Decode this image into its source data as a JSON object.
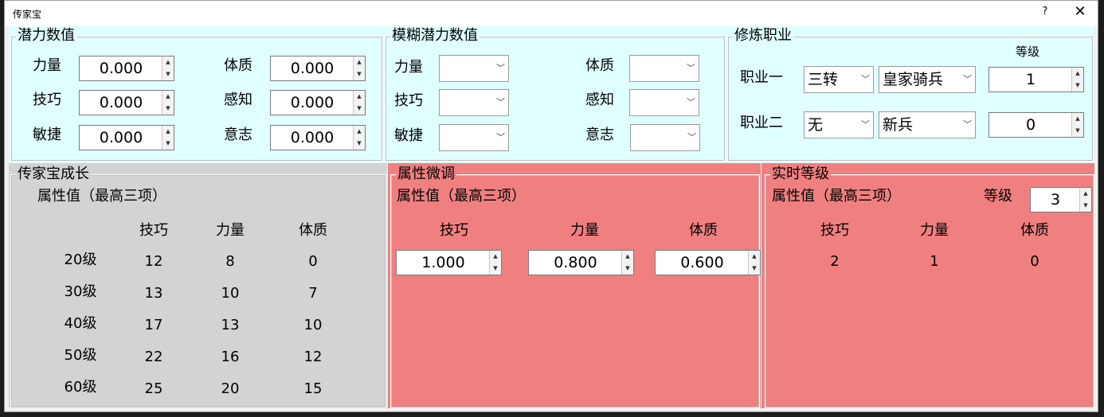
{
  "window": {
    "title": "传家宝",
    "help": "?",
    "close": "✕"
  },
  "potential": {
    "title": "潜力数值",
    "fields": [
      {
        "label": "力量",
        "value": "0.000"
      },
      {
        "label": "技巧",
        "value": "0.000"
      },
      {
        "label": "敏捷",
        "value": "0.000"
      },
      {
        "label": "体质",
        "value": "0.000"
      },
      {
        "label": "感知",
        "value": "0.000"
      },
      {
        "label": "意志",
        "value": "0.000"
      }
    ]
  },
  "fuzzy": {
    "title": "模糊潜力数值",
    "fields": [
      {
        "label": "力量",
        "value": ""
      },
      {
        "label": "技巧",
        "value": ""
      },
      {
        "label": "敏捷",
        "value": ""
      },
      {
        "label": "体质",
        "value": ""
      },
      {
        "label": "感知",
        "value": ""
      },
      {
        "label": "意志",
        "value": ""
      }
    ]
  },
  "jobs": {
    "title": "修炼职业",
    "level_header": "等级",
    "rows": [
      {
        "label": "职业一",
        "stage": "三转",
        "job": "皇家骑兵",
        "level": "1"
      },
      {
        "label": "职业二",
        "stage": "无",
        "job": "新兵",
        "level": "0"
      }
    ]
  },
  "growth": {
    "title": "传家宝成长",
    "subtitle": "属性值（最高三项）",
    "headers": [
      "技巧",
      "力量",
      "体质"
    ],
    "rows": [
      {
        "level": "20级",
        "values": [
          "12",
          "8",
          "0"
        ]
      },
      {
        "level": "30级",
        "values": [
          "13",
          "10",
          "7"
        ]
      },
      {
        "level": "40级",
        "values": [
          "17",
          "13",
          "10"
        ]
      },
      {
        "level": "50级",
        "values": [
          "22",
          "16",
          "12"
        ]
      },
      {
        "level": "60级",
        "values": [
          "25",
          "20",
          "15"
        ]
      }
    ]
  },
  "tweak": {
    "title": "属性微调",
    "subtitle": "属性值（最高三项）",
    "headers": [
      "技巧",
      "力量",
      "体质"
    ],
    "values": [
      "1.000",
      "0.800",
      "0.600"
    ]
  },
  "realtime": {
    "title": "实时等级",
    "subtitle": "属性值（最高三项）",
    "level_label": "等级",
    "level_value": "3",
    "headers": [
      "技巧",
      "力量",
      "体质"
    ],
    "values": [
      "2",
      "1",
      "0"
    ]
  },
  "colors": {
    "cyan_panel": "#e0ffff",
    "gray_panel": "#d3d3d3",
    "red_panel": "#f08080"
  },
  "icons": {
    "spin_up": "up-arrow-icon",
    "spin_down": "down-arrow-icon",
    "combo": "chevron-down-icon"
  }
}
